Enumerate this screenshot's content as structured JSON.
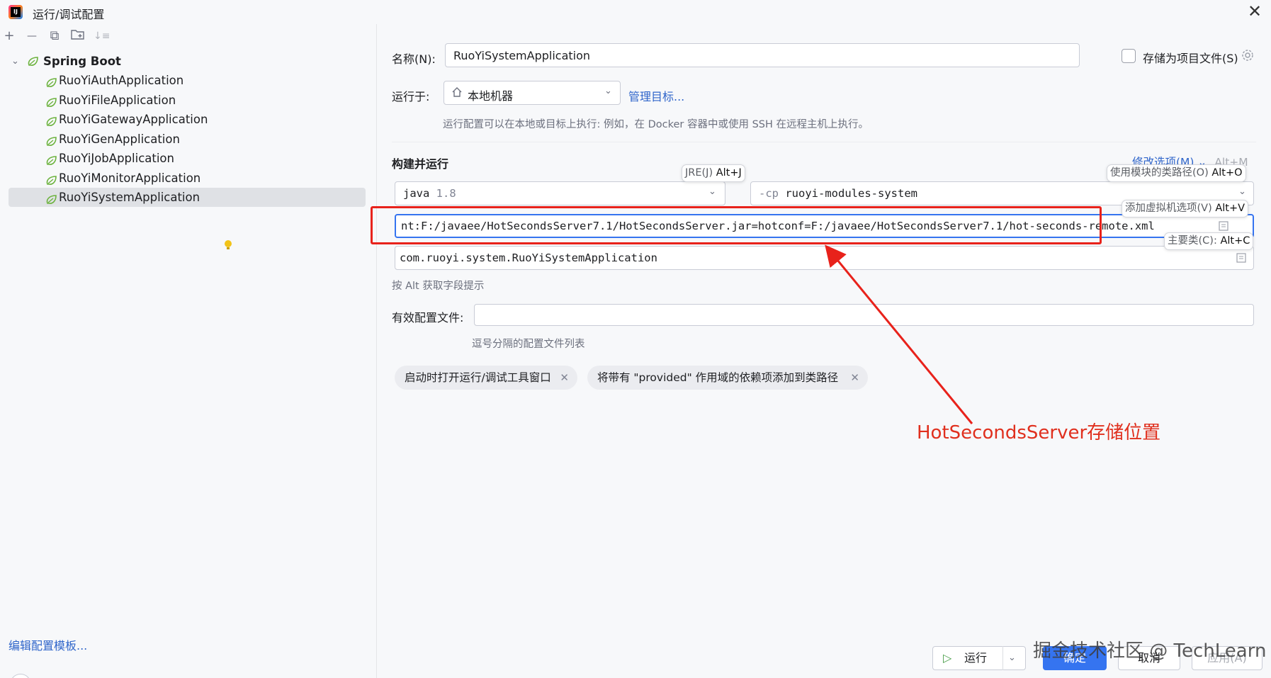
{
  "window": {
    "title": "运行/调试配置",
    "logo_text": "IJ"
  },
  "toolbar": {
    "add": "+",
    "remove": "—",
    "copy": "⧉",
    "new_folder": "folder",
    "sort": "↓≡"
  },
  "tree": {
    "root": "Spring Boot",
    "items": [
      "RuoYiAuthApplication",
      "RuoYiFileApplication",
      "RuoYiGatewayApplication",
      "RuoYiGenApplication",
      "RuoYiJobApplication",
      "RuoYiMonitorApplication",
      "RuoYiSystemApplication"
    ],
    "selected_index": 6
  },
  "left_footer": {
    "edit_templates": "编辑配置模板...",
    "help": "?"
  },
  "form": {
    "name_label": "名称(N):",
    "name_value": "RuoYiSystemApplication",
    "store_as_file_label": "存储为项目文件(S)",
    "run_on_label": "运行于:",
    "run_on_value": "本地机器",
    "manage_targets": "管理目标...",
    "run_on_hint": "运行配置可以在本地或目标上执行: 例如，在 Docker 容器中或使用 SSH 在远程主机上执行。",
    "section_title": "构建并运行",
    "modify_options": "修改选项(M)",
    "modify_options_shortcut": "Alt+M",
    "jre_prefix": "java",
    "jre_version": "1.8",
    "cp_prefix": "-cp",
    "cp_value": "ruoyi-modules-system",
    "vm_options": "nt:F:/javaee/HotSecondsServer7.1/HotSecondsServer.jar=hotconf=F:/javaee/HotSecondsServer7.1/hot-seconds-remote.xml",
    "main_class": "com.ruoyi.system.RuoYiSystemApplication",
    "alt_hint": "按 Alt 获取字段提示",
    "profiles_label": "有效配置文件:",
    "profiles_value": "",
    "profiles_hint": "逗号分隔的配置文件列表",
    "chips": [
      "启动时打开运行/调试工具窗口",
      "将带有 \"provided\" 作用域的依赖项添加到类路径"
    ]
  },
  "tooltips": {
    "jre": {
      "text": "JRE(J) ",
      "key": "Alt+J"
    },
    "module_cp": {
      "text": "使用模块的类路径(O) ",
      "key": "Alt+O"
    },
    "vm": {
      "text": "添加虚拟机选项(V) ",
      "key": "Alt+V"
    },
    "main": {
      "text": "主要类(C): ",
      "key": "Alt+C"
    }
  },
  "buttons": {
    "run": "运行",
    "ok": "确定",
    "cancel": "取消",
    "apply": "应用(A)"
  },
  "annotation": {
    "label": "HotSecondsServer存储位置",
    "color": "#e0301e"
  },
  "watermark": "掘金技术社区 @ TechLearn",
  "colors": {
    "accent": "#3574f0",
    "link": "#2f65ca",
    "selection": "#dfe1e5",
    "spring": "#6db33f",
    "annotation": "#e8221b"
  }
}
